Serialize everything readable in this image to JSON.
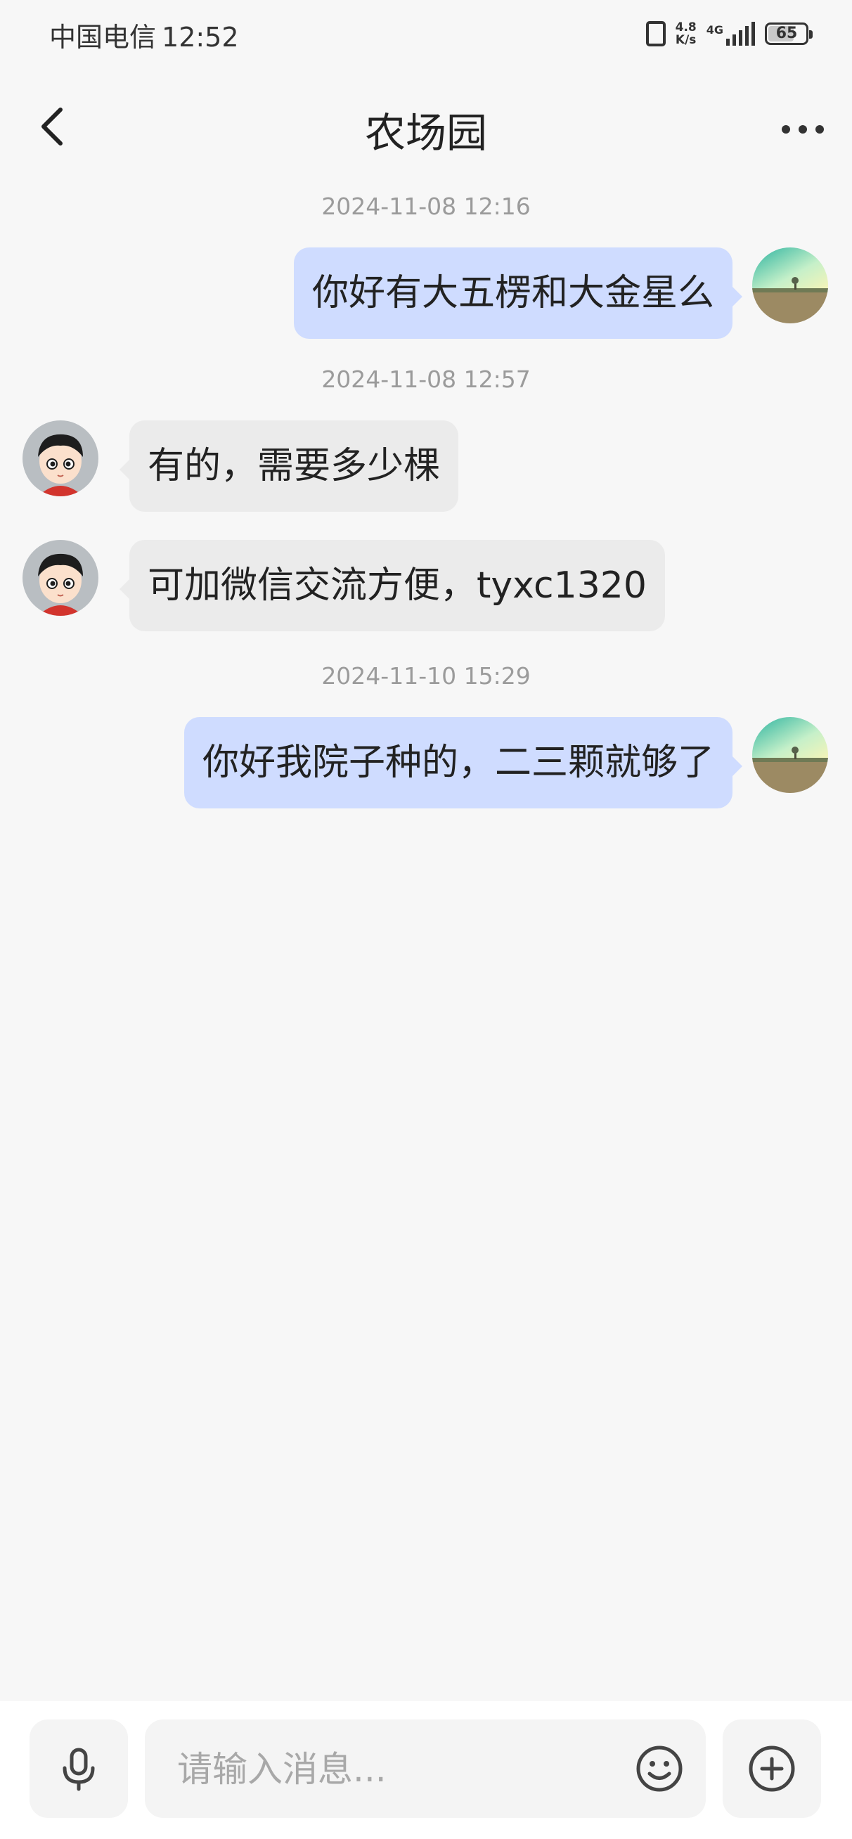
{
  "status_bar": {
    "carrier": "中国电信",
    "time": "12:52",
    "net_speed_value": "4.8",
    "net_speed_unit": "K/s",
    "network_type": "4G",
    "battery_level": "65",
    "icons": [
      "vibrate-icon",
      "signal-icon",
      "battery-icon"
    ]
  },
  "header": {
    "title": "农场园",
    "icons": [
      "back-arrow-icon",
      "more-dots-icon"
    ]
  },
  "messages": [
    {
      "timestamp": "2024-11-08 12:16"
    },
    {
      "direction": "out",
      "text": "你好有大五楞和大金星么"
    },
    {
      "timestamp": "2024-11-08 12:57"
    },
    {
      "direction": "in",
      "text": "有的，需要多少棵"
    },
    {
      "direction": "in",
      "text": "可加微信交流方便，tyxc1320"
    },
    {
      "timestamp": "2024-11-10 15:29"
    },
    {
      "direction": "out",
      "text": "你好我院子种的，二三颗就够了"
    }
  ],
  "input_bar": {
    "placeholder": "请输入消息...",
    "value": "",
    "icons": [
      "microphone-icon",
      "emoji-icon",
      "plus-circle-icon"
    ]
  },
  "colors": {
    "background": "#f7f7f7",
    "outgoing_bubble": "#cfdcff",
    "incoming_bubble": "#ebebeb",
    "timestamp_text": "#9b9b9b"
  }
}
